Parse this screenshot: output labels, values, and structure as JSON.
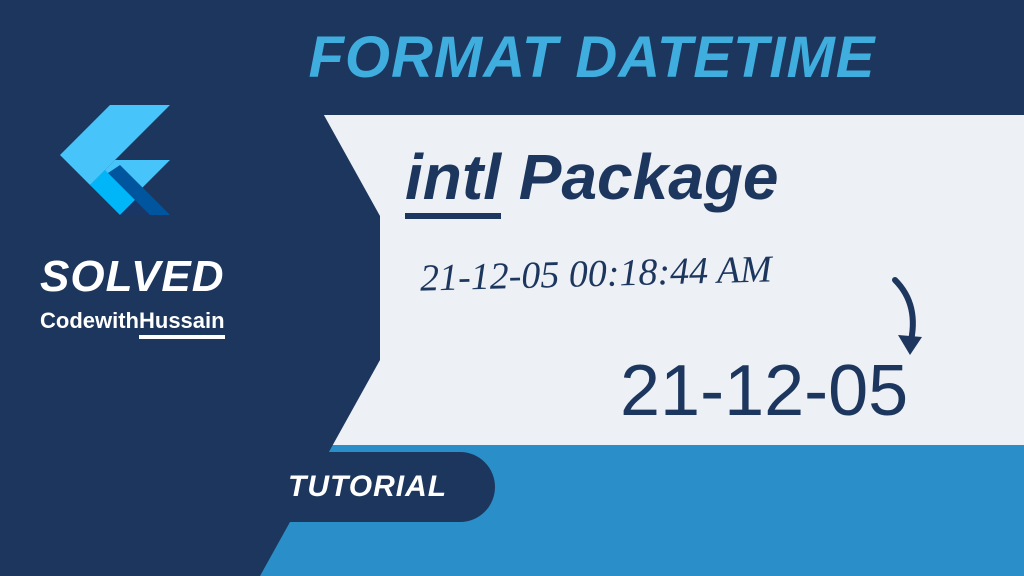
{
  "header": {
    "title": "FORMAT DATETIME"
  },
  "sidebar": {
    "badge": "SOLVED",
    "author_prefix": "Codewith",
    "author_name": "Hussain"
  },
  "main": {
    "package_name": "intl",
    "package_suffix": " Package",
    "datetime_before": "21-12-05 00:18:44 AM",
    "datetime_after": "21-12-05"
  },
  "footer": {
    "badge": "TUTORIAL"
  }
}
